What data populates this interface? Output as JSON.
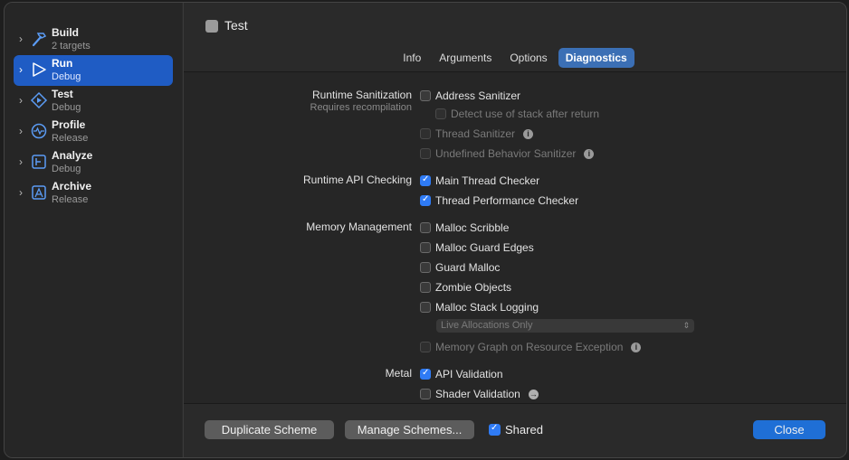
{
  "sidebar": {
    "items": [
      {
        "title": "Build",
        "sub": "2 targets"
      },
      {
        "title": "Run",
        "sub": "Debug"
      },
      {
        "title": "Test",
        "sub": "Debug"
      },
      {
        "title": "Profile",
        "sub": "Release"
      },
      {
        "title": "Analyze",
        "sub": "Debug"
      },
      {
        "title": "Archive",
        "sub": "Release"
      }
    ]
  },
  "header": {
    "title": "Test"
  },
  "tabs": [
    "Info",
    "Arguments",
    "Options",
    "Diagnostics"
  ],
  "sections": {
    "runtime_sanitization": {
      "label": "Runtime Sanitization",
      "sub": "Requires recompilation"
    },
    "runtime_api": {
      "label": "Runtime API Checking"
    },
    "memory": {
      "label": "Memory Management"
    },
    "metal": {
      "label": "Metal"
    }
  },
  "options": {
    "address_sanitizer": "Address Sanitizer",
    "detect_stack": "Detect use of stack after return",
    "thread_sanitizer": "Thread Sanitizer",
    "ub_sanitizer": "Undefined Behavior Sanitizer",
    "main_thread_checker": "Main Thread Checker",
    "thread_perf_checker": "Thread Performance Checker",
    "malloc_scribble": "Malloc Scribble",
    "malloc_guard_edges": "Malloc Guard Edges",
    "guard_malloc": "Guard Malloc",
    "zombie_objects": "Zombie Objects",
    "malloc_stack_logging": "Malloc Stack Logging",
    "live_allocations": "Live Allocations Only",
    "memory_graph": "Memory Graph on Resource Exception",
    "api_validation": "API Validation",
    "shader_validation": "Shader Validation"
  },
  "footer": {
    "duplicate": "Duplicate Scheme",
    "manage": "Manage Schemes...",
    "shared": "Shared",
    "close": "Close"
  },
  "colors": {
    "accent": "#1f6fd6",
    "selected": "#1f5cc4"
  }
}
